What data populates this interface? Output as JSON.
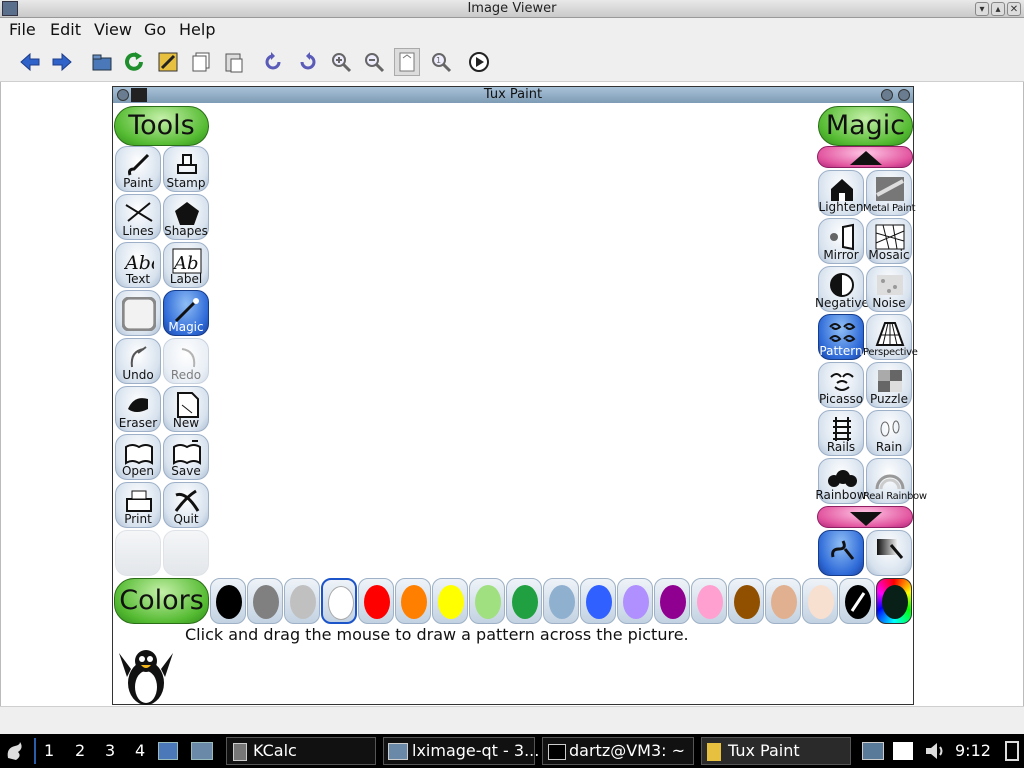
{
  "window": {
    "title": "Image Viewer"
  },
  "menu": [
    "File",
    "Edit",
    "View",
    "Go",
    "Help"
  ],
  "toolbar": [
    "back-icon",
    "forward-icon",
    "open-folder-icon",
    "reload-icon",
    "edit-icon",
    "copy-icon",
    "paste-icon",
    "rotate-left-icon",
    "rotate-right-icon",
    "zoom-in-icon",
    "zoom-out-icon",
    "fit-window-icon",
    "zoom-original-icon",
    "slideshow-icon"
  ],
  "tuxpaint": {
    "title": "Tux Paint",
    "tools_label": "Tools",
    "magic_label": "Magic",
    "colors_label": "Colors",
    "tools": [
      {
        "label": "Paint",
        "icon": "brush-icon"
      },
      {
        "label": "Stamp",
        "icon": "stamp-icon"
      },
      {
        "label": "Lines",
        "icon": "lines-icon"
      },
      {
        "label": "Shapes",
        "icon": "pentagon-icon"
      },
      {
        "label": "Text",
        "icon": "text-icon"
      },
      {
        "label": "Label",
        "icon": "label-icon"
      },
      {
        "label": "",
        "icon": "blank-icon"
      },
      {
        "label": "Magic",
        "icon": "magic-wand-icon",
        "selected": true
      },
      {
        "label": "Undo",
        "icon": "undo-icon"
      },
      {
        "label": "Redo",
        "icon": "redo-icon",
        "disabled": true
      },
      {
        "label": "Eraser",
        "icon": "eraser-icon"
      },
      {
        "label": "New",
        "icon": "new-page-icon"
      },
      {
        "label": "Open",
        "icon": "open-book-icon"
      },
      {
        "label": "Save",
        "icon": "save-book-icon"
      },
      {
        "label": "Print",
        "icon": "printer-icon"
      },
      {
        "label": "Quit",
        "icon": "quit-icon"
      }
    ],
    "magic": [
      {
        "label": "Lighten",
        "icon": "house-icon"
      },
      {
        "label": "Metal Paint",
        "icon": "metal-icon"
      },
      {
        "label": "Mirror",
        "icon": "mirror-icon"
      },
      {
        "label": "Mosaic",
        "icon": "mosaic-icon"
      },
      {
        "label": "Negative",
        "icon": "negative-icon"
      },
      {
        "label": "Noise",
        "icon": "noise-icon"
      },
      {
        "label": "Pattern",
        "icon": "pattern-icon",
        "selected": true
      },
      {
        "label": "Perspective",
        "icon": "perspective-icon"
      },
      {
        "label": "Picasso",
        "icon": "picasso-icon"
      },
      {
        "label": "Puzzle",
        "icon": "puzzle-icon"
      },
      {
        "label": "Rails",
        "icon": "rails-icon"
      },
      {
        "label": "Rain",
        "icon": "rain-icon"
      },
      {
        "label": "Rainbow",
        "icon": "rainbow-icon"
      },
      {
        "label": "Real Rainbow",
        "icon": "real-rainbow-icon"
      }
    ],
    "colors": [
      "#000000",
      "#808080",
      "#c0c0c0",
      "#ffffff",
      "#ff0000",
      "#ff8000",
      "#ffff00",
      "#a0e080",
      "#20a040",
      "#90b0d0",
      "#3060ff",
      "#b090ff",
      "#900090",
      "#ffa0d0",
      "#905000",
      "#e0b090",
      "#f8e0d0"
    ],
    "selected_color_index": 3,
    "instruction": "Click and drag the mouse to draw a pattern across the picture."
  },
  "taskbar": {
    "desktops": [
      "1",
      "2",
      "3",
      "4"
    ],
    "tasks": [
      "KCalc",
      "lximage-qt - 3...",
      "dartz@VM3: ~",
      "Tux Paint"
    ],
    "clock": "9:12"
  }
}
